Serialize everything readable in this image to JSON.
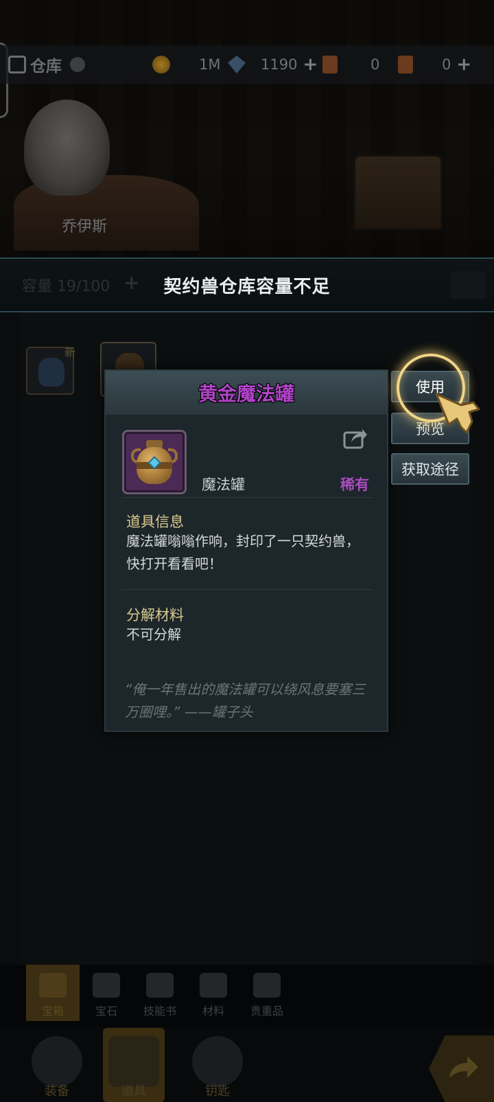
{
  "top_bar": {
    "title": "仓库",
    "currencies": [
      {
        "icon": "gold-coin-icon",
        "value": "1M"
      },
      {
        "icon": "diamond-icon",
        "value": "1190"
      },
      {
        "icon": "ticket-icon",
        "value": "0"
      },
      {
        "icon": "scroll-icon",
        "value": "0"
      }
    ]
  },
  "character": {
    "name": "乔伊斯"
  },
  "banner": {
    "text": "契约兽仓库容量不足",
    "capacity_label": "容量 19/100"
  },
  "inventory": {
    "new_tag": "新"
  },
  "popup": {
    "title": "黄金魔法罐",
    "title_color": "#b044c8",
    "item_type": "魔法罐",
    "rarity": "稀有",
    "rarity_color": "#a84bc0",
    "info_title": "道具信息",
    "info_text": "魔法罐嗡嗡作响，封印了一只契约兽，快打开看看吧！",
    "decompose_title": "分解材料",
    "decompose_text": "不可分解",
    "flavor_text": "“俺一年售出的魔法罐可以绕风息要塞三万圈哩。” ——罐子头"
  },
  "actions": {
    "use": "使用",
    "preview": "预览",
    "source": "获取途径"
  },
  "sub_tabs": [
    {
      "label": "宝箱",
      "active": true
    },
    {
      "label": "宝石",
      "active": false
    },
    {
      "label": "技能书",
      "active": false
    },
    {
      "label": "材料",
      "active": false
    },
    {
      "label": "贵重品",
      "active": false
    }
  ],
  "main_tabs": [
    {
      "label": "装备",
      "active": false
    },
    {
      "label": "道具",
      "active": true
    },
    {
      "label": "钥匙",
      "active": false
    }
  ]
}
